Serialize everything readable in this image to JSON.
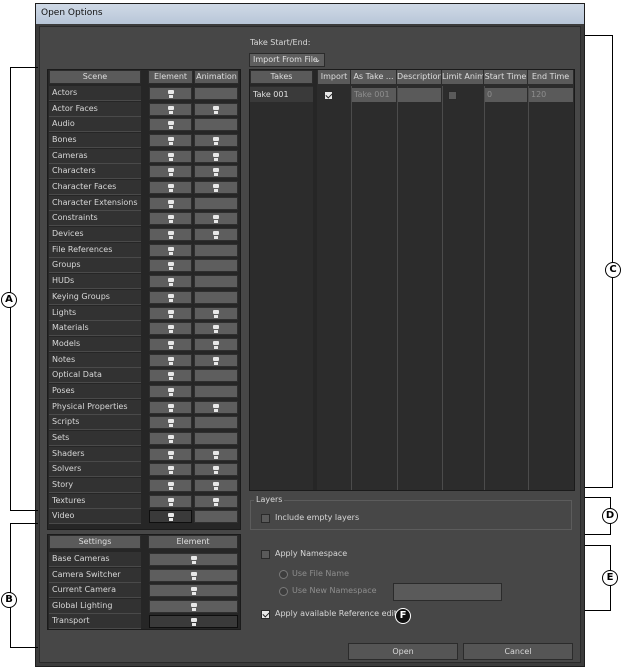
{
  "window": {
    "title": "Open Options"
  },
  "take_range": {
    "label": "Take Start/End:",
    "dropdown_value": "Import From File"
  },
  "scene": {
    "header": "Scene",
    "col_element": "Element",
    "col_animation": "Animation",
    "items": [
      {
        "label": "Actors",
        "anim": false
      },
      {
        "label": "Actor Faces",
        "anim": true
      },
      {
        "label": "Audio",
        "anim": false
      },
      {
        "label": "Bones",
        "anim": true
      },
      {
        "label": "Cameras",
        "anim": true
      },
      {
        "label": "Characters",
        "anim": true
      },
      {
        "label": "Character Faces",
        "anim": true
      },
      {
        "label": "Character Extensions",
        "anim": false
      },
      {
        "label": "Constraints",
        "anim": true
      },
      {
        "label": "Devices",
        "anim": true
      },
      {
        "label": "File References",
        "anim": false
      },
      {
        "label": "Groups",
        "anim": false
      },
      {
        "label": "HUDs",
        "anim": false
      },
      {
        "label": "Keying Groups",
        "anim": false
      },
      {
        "label": "Lights",
        "anim": true
      },
      {
        "label": "Materials",
        "anim": true
      },
      {
        "label": "Models",
        "anim": true
      },
      {
        "label": "Notes",
        "anim": true
      },
      {
        "label": "Optical Data",
        "anim": false
      },
      {
        "label": "Poses",
        "anim": false
      },
      {
        "label": "Physical Properties",
        "anim": true
      },
      {
        "label": "Scripts",
        "anim": false
      },
      {
        "label": "Sets",
        "anim": false
      },
      {
        "label": "Shaders",
        "anim": true
      },
      {
        "label": "Solvers",
        "anim": true
      },
      {
        "label": "Story",
        "anim": true
      },
      {
        "label": "Textures",
        "anim": true
      },
      {
        "label": "Video",
        "anim": false
      }
    ]
  },
  "settings": {
    "header": "Settings",
    "col_element": "Element",
    "items": [
      "Base Cameras",
      "Camera Switcher",
      "Current Camera",
      "Global Lighting",
      "Transport"
    ]
  },
  "takes": {
    "list_header": "Takes",
    "list_items": [
      "Take 001"
    ],
    "columns": [
      "Import",
      "As Take ...",
      "Description",
      "Limit Anim",
      "Start Time",
      "End Time"
    ],
    "row": {
      "import": true,
      "as_take": "Take 001",
      "description": "",
      "limit_anim": false,
      "start_time": "0",
      "end_time": "120"
    }
  },
  "layers": {
    "group_label": "Layers",
    "include_empty_label": "Include empty layers",
    "include_empty_checked": false
  },
  "namespace": {
    "apply_label": "Apply Namespace",
    "apply_checked": false,
    "use_file_name_label": "Use File Name",
    "use_new_label": "Use New Namespace",
    "new_value": ""
  },
  "reference": {
    "label": "Apply available Reference edits",
    "checked": true
  },
  "buttons": {
    "open": "Open",
    "cancel": "Cancel"
  },
  "callouts": {
    "a": "A",
    "b": "B",
    "c": "C",
    "d": "D",
    "e": "E",
    "f": "F"
  }
}
